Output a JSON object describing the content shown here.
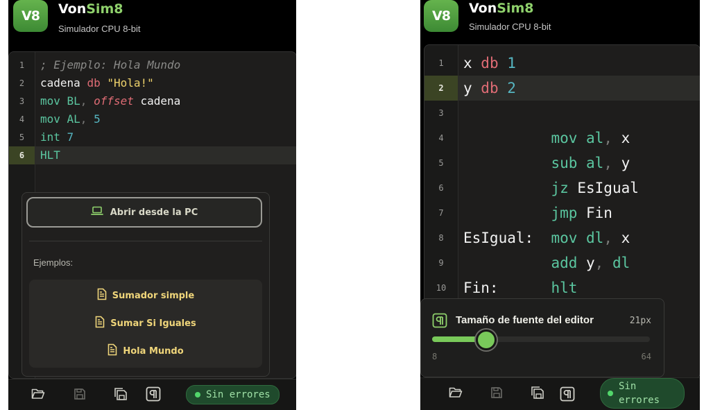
{
  "app": {
    "logo_text": "V8",
    "title_prefix": "Von",
    "title_accent": "Sim8",
    "subtitle": "Simulador CPU 8-bit",
    "accent_color": "#8fd16c"
  },
  "left": {
    "line_numbers": [
      "1",
      "2",
      "3",
      "4",
      "5",
      "6"
    ],
    "active_line": "6",
    "open_label": "Abrir desde la PC",
    "examples_label": "Ejemplos:",
    "examples": [
      "Sumador simple",
      "Sumar Si Iguales",
      "Hola Mundo"
    ],
    "status": "Sin errores"
  },
  "right": {
    "line_numbers": [
      "1",
      "2",
      "3",
      "4",
      "5",
      "6",
      "7",
      "8",
      "9",
      "10"
    ],
    "active_line": "2",
    "font_size_title": "Tamaño de fuente del editor",
    "font_size_value": "21px",
    "slider_min": "8",
    "slider_max": "64",
    "slider_fraction": 0.24,
    "status_line1": "Sin",
    "status_line2": "errores"
  },
  "code_left": [
    [
      {
        "t": "; Ejemplo: Hola Mundo",
        "c": "comment"
      }
    ],
    [
      {
        "t": "cadena ",
        "c": "id"
      },
      {
        "t": "db ",
        "c": "kw"
      },
      {
        "t": "\"Hola!\"",
        "c": "str"
      }
    ],
    [
      {
        "t": "mov ",
        "c": "op"
      },
      {
        "t": "BL",
        "c": "reg"
      },
      {
        "t": ", ",
        "c": "punc"
      },
      {
        "t": "offset",
        "c": "off"
      },
      {
        "t": " cadena",
        "c": "id"
      }
    ],
    [
      {
        "t": "mov ",
        "c": "op"
      },
      {
        "t": "AL",
        "c": "reg"
      },
      {
        "t": ", ",
        "c": "punc"
      },
      {
        "t": "5",
        "c": "num"
      }
    ],
    [
      {
        "t": "int ",
        "c": "op"
      },
      {
        "t": "7",
        "c": "num"
      }
    ],
    [
      {
        "t": "HLT",
        "c": "op"
      }
    ]
  ],
  "code_right": [
    [
      {
        "t": "x ",
        "c": "id"
      },
      {
        "t": "db ",
        "c": "kw"
      },
      {
        "t": "1",
        "c": "num"
      }
    ],
    [
      {
        "t": "y ",
        "c": "id"
      },
      {
        "t": "db ",
        "c": "kw"
      },
      {
        "t": "2",
        "c": "num"
      }
    ],
    [],
    [
      {
        "t": "          ",
        "c": "id"
      },
      {
        "t": "mov ",
        "c": "op"
      },
      {
        "t": "al",
        "c": "reg"
      },
      {
        "t": ", ",
        "c": "punc"
      },
      {
        "t": "x",
        "c": "id"
      }
    ],
    [
      {
        "t": "          ",
        "c": "id"
      },
      {
        "t": "sub ",
        "c": "op"
      },
      {
        "t": "al",
        "c": "reg"
      },
      {
        "t": ", ",
        "c": "punc"
      },
      {
        "t": "y",
        "c": "id"
      }
    ],
    [
      {
        "t": "          ",
        "c": "id"
      },
      {
        "t": "jz ",
        "c": "op"
      },
      {
        "t": "EsIgual",
        "c": "id"
      }
    ],
    [
      {
        "t": "          ",
        "c": "id"
      },
      {
        "t": "jmp ",
        "c": "op"
      },
      {
        "t": "Fin",
        "c": "id"
      }
    ],
    [
      {
        "t": "EsIgual:  ",
        "c": "id"
      },
      {
        "t": "mov ",
        "c": "op"
      },
      {
        "t": "dl",
        "c": "reg"
      },
      {
        "t": ", ",
        "c": "punc"
      },
      {
        "t": "x",
        "c": "id"
      }
    ],
    [
      {
        "t": "          ",
        "c": "id"
      },
      {
        "t": "add ",
        "c": "op"
      },
      {
        "t": "y",
        "c": "id"
      },
      {
        "t": ", ",
        "c": "punc"
      },
      {
        "t": "dl",
        "c": "reg"
      }
    ],
    [
      {
        "t": "Fin:      ",
        "c": "id"
      },
      {
        "t": "hlt",
        "c": "op"
      }
    ]
  ],
  "icons": [
    "folder-open-icon",
    "save-icon",
    "save-as-icon",
    "pilcrow-icon",
    "file-text-icon",
    "laptop-icon"
  ]
}
